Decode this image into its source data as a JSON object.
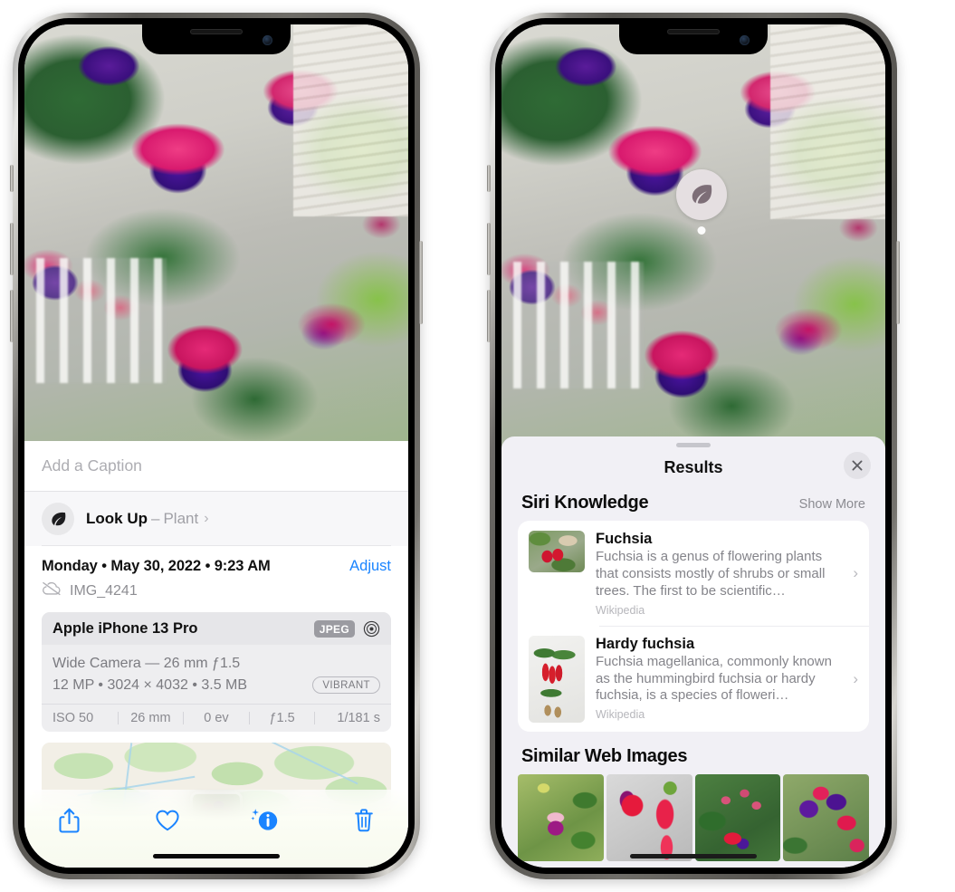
{
  "left_phone": {
    "photo": {
      "alt": "fuchsia-flowers-photo"
    },
    "caption_field": {
      "placeholder": "Add a Caption",
      "value": ""
    },
    "look_up": {
      "label": "Look Up",
      "dash": "–",
      "kind": "Plant",
      "chevron": "›",
      "icon": "leaf-icon"
    },
    "metadata": {
      "date": "Monday • May 30, 2022 • 9:23 AM",
      "adjust_label": "Adjust",
      "filename": "IMG_4241",
      "cloud_icon": "icloud-slash-icon"
    },
    "exif": {
      "model": "Apple iPhone 13 Pro",
      "format_chip": "JPEG",
      "aperture_icon": "aperture-icon",
      "lens_line": "Wide Camera — 26 mm ƒ1.5",
      "size_line": "12 MP • 3024 × 4032 • 3.5 MB",
      "style_chip": "VIBRANT",
      "footer": [
        "ISO 50",
        "26 mm",
        "0 ev",
        "ƒ1.5",
        "1/181 s"
      ]
    },
    "map": {
      "pin": "photo-location-pin"
    },
    "toolbar": [
      {
        "name": "share-button",
        "icon": "share-icon"
      },
      {
        "name": "favorite-button",
        "icon": "heart-icon"
      },
      {
        "name": "info-button",
        "icon": "info-sparkle-icon"
      },
      {
        "name": "delete-button",
        "icon": "trash-icon"
      }
    ],
    "accent_color": "#1a84ff"
  },
  "right_phone": {
    "photo_badge": {
      "icon": "leaf-icon",
      "name": "visual-lookup-leaf-badge"
    },
    "panel": {
      "grabber": "drag-handle",
      "title": "Results",
      "close_icon": "close-icon"
    },
    "siri_knowledge": {
      "section_title": "Siri Knowledge",
      "show_more": "Show More",
      "cards": [
        {
          "title": "Fuchsia",
          "description": "Fuchsia is a genus of flowering plants that consists mostly of shrubs or small trees. The first to be scientific…",
          "source": "Wikipedia",
          "chevron": "›",
          "thumb": "fuchsia-thumbnail"
        },
        {
          "title": "Hardy fuchsia",
          "description": "Fuchsia magellanica, commonly known as the hummingbird fuchsia or hardy fuchsia, is a species of floweri…",
          "source": "Wikipedia",
          "chevron": "›",
          "thumb": "hardy-fuchsia-thumbnail"
        }
      ]
    },
    "similar_web_images": {
      "section_title": "Similar Web Images",
      "thumbs": [
        "web-image-1",
        "web-image-2",
        "web-image-3",
        "web-image-4"
      ]
    }
  }
}
